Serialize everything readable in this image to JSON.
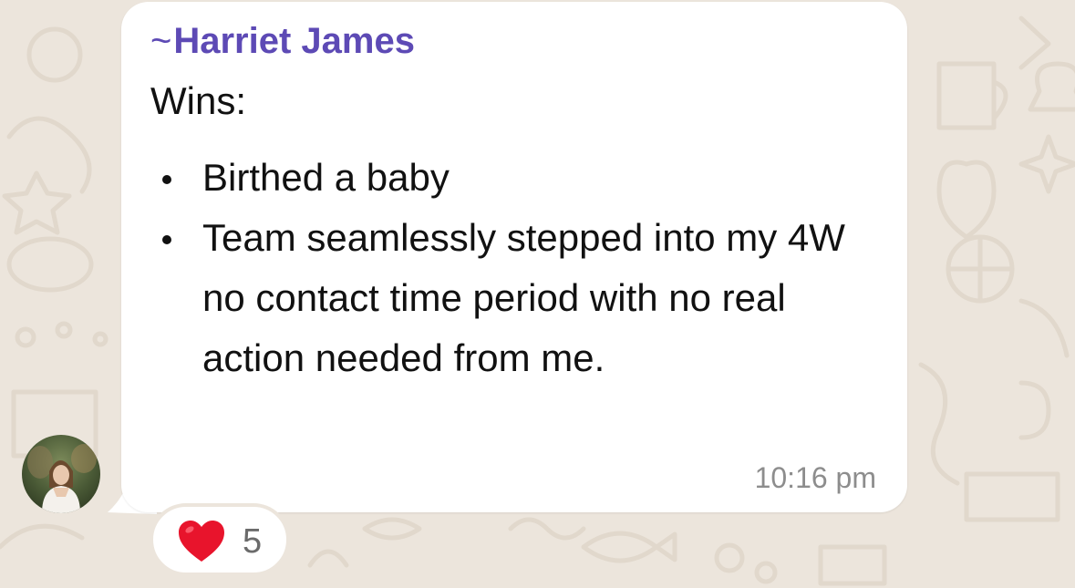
{
  "message": {
    "sender_prefix": "~",
    "sender_name": "Harriet James",
    "sender_color": "#5d4ab5",
    "title": "Wins:",
    "bullets": [
      "Birthed a baby",
      "Team seamlessly stepped into my 4W no contact time period with no real action needed from me."
    ],
    "timestamp": "10:16 pm"
  },
  "avatar": {
    "icon": "profile-photo"
  },
  "reaction": {
    "emoji_icon": "red-heart-icon",
    "count": "5"
  },
  "colors": {
    "background": "#ece5dc",
    "bubble": "#ffffff",
    "heart": "#e8142c"
  }
}
